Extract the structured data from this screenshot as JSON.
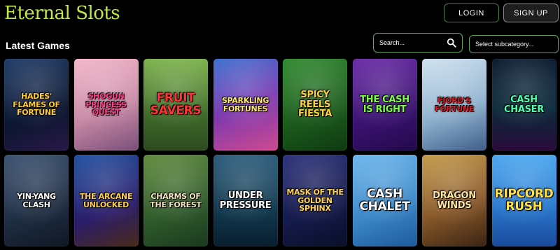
{
  "header": {
    "logo": "Eternal Slots",
    "login_label": "LOGIN",
    "signup_label": "SIGN UP"
  },
  "main": {
    "section_title": "Latest Games",
    "search": {
      "placeholder": "Search..."
    },
    "subcategory": {
      "selected": "Select subcategory..."
    }
  },
  "games": [
    {
      "title": "HADES' FLAMES OF FORTUNE",
      "bg": "linear-gradient(160deg,#1d3a66,#0b1630 60%,#2a1848)",
      "color": "#ffcc33",
      "size": "t-sm"
    },
    {
      "title": "SHOGUN PRINCESS QUEST",
      "bg": "linear-gradient(160deg,#f3b6c9,#c98aa6 55%,#7a4f7a)",
      "color": "#ff3f8a",
      "size": "t-sm"
    },
    {
      "title": "FRUIT SAVERS",
      "bg": "linear-gradient(180deg,#7bb14a,#3f6b2a 60%,#2d4a1f)",
      "color": "#ff3333",
      "size": "t-lg"
    },
    {
      "title": "SPARKLING FORTUNES",
      "bg": "linear-gradient(160deg,#3a6fd0,#7a38b0 50%,#d04a8f)",
      "color": "#ffe86b",
      "size": "t-sm"
    },
    {
      "title": "SPICY REELS FIESTA",
      "bg": "linear-gradient(160deg,#2f8a2f,#1b5a1b 60%,#0f3a12)",
      "color": "#ffd23a",
      "size": ""
    },
    {
      "title": "THE CASH IS RIGHT",
      "bg": "linear-gradient(160deg,#6a2aa8,#3a1270 60%,#22094a)",
      "color": "#7dff4a",
      "size": ""
    },
    {
      "title": "FJORD'S FORTUNE",
      "bg": "linear-gradient(160deg,#cfe1ef,#8fb2cf 55%,#405e8a)",
      "color": "#d8202a",
      "size": "t-sm"
    },
    {
      "title": "CASH CHASER",
      "bg": "linear-gradient(180deg,#0a1a2f,#0b2a3a 55%,#2a0a3a)",
      "color": "#4dffb0",
      "size": ""
    },
    {
      "title": "YIN-YANG CLASH",
      "bg": "linear-gradient(160deg,#3a5070,#1f2d42 60%,#0f1724)",
      "color": "#ffffff",
      "size": "t-sm"
    },
    {
      "title": "THE ARCANE UNLOCKED",
      "bg": "linear-gradient(160deg,#1e4fa0,#2a1c6a 60%,#4a2a1a)",
      "color": "#ffcf4a",
      "size": "t-sm"
    },
    {
      "title": "CHARMS OF THE FOREST",
      "bg": "linear-gradient(160deg,#5f8a3a,#2f5a2a 60%,#1a3a1f)",
      "color": "#f3e6c0",
      "size": "t-sm"
    },
    {
      "title": "UNDER PRESSURE",
      "bg": "linear-gradient(180deg,#2a5a7a,#12394f 60%,#081e2e)",
      "color": "#ffffff",
      "size": ""
    },
    {
      "title": "MASK OF THE GOLDEN SPHINX",
      "bg": "linear-gradient(160deg,#2a2f7a,#141a4a 60%,#0a0f2a)",
      "color": "#ffd25a",
      "size": "t-sm"
    },
    {
      "title": "CASH CHALET",
      "bg": "linear-gradient(160deg,#6ab6ee,#3a86c6 60%,#1e5a9a)",
      "color": "#ffffff",
      "size": "t-lg"
    },
    {
      "title": "DRAGON WINDS",
      "bg": "linear-gradient(160deg,#c49a4a,#8a5a2a 55%,#3a2414)",
      "color": "#ffe6a0",
      "size": ""
    },
    {
      "title": "RIPCORD RUSH",
      "bg": "linear-gradient(180deg,#4aa6ee,#2a7ad0 55%,#1a4a9a)",
      "color": "#ffe24a",
      "size": "t-lg"
    }
  ]
}
